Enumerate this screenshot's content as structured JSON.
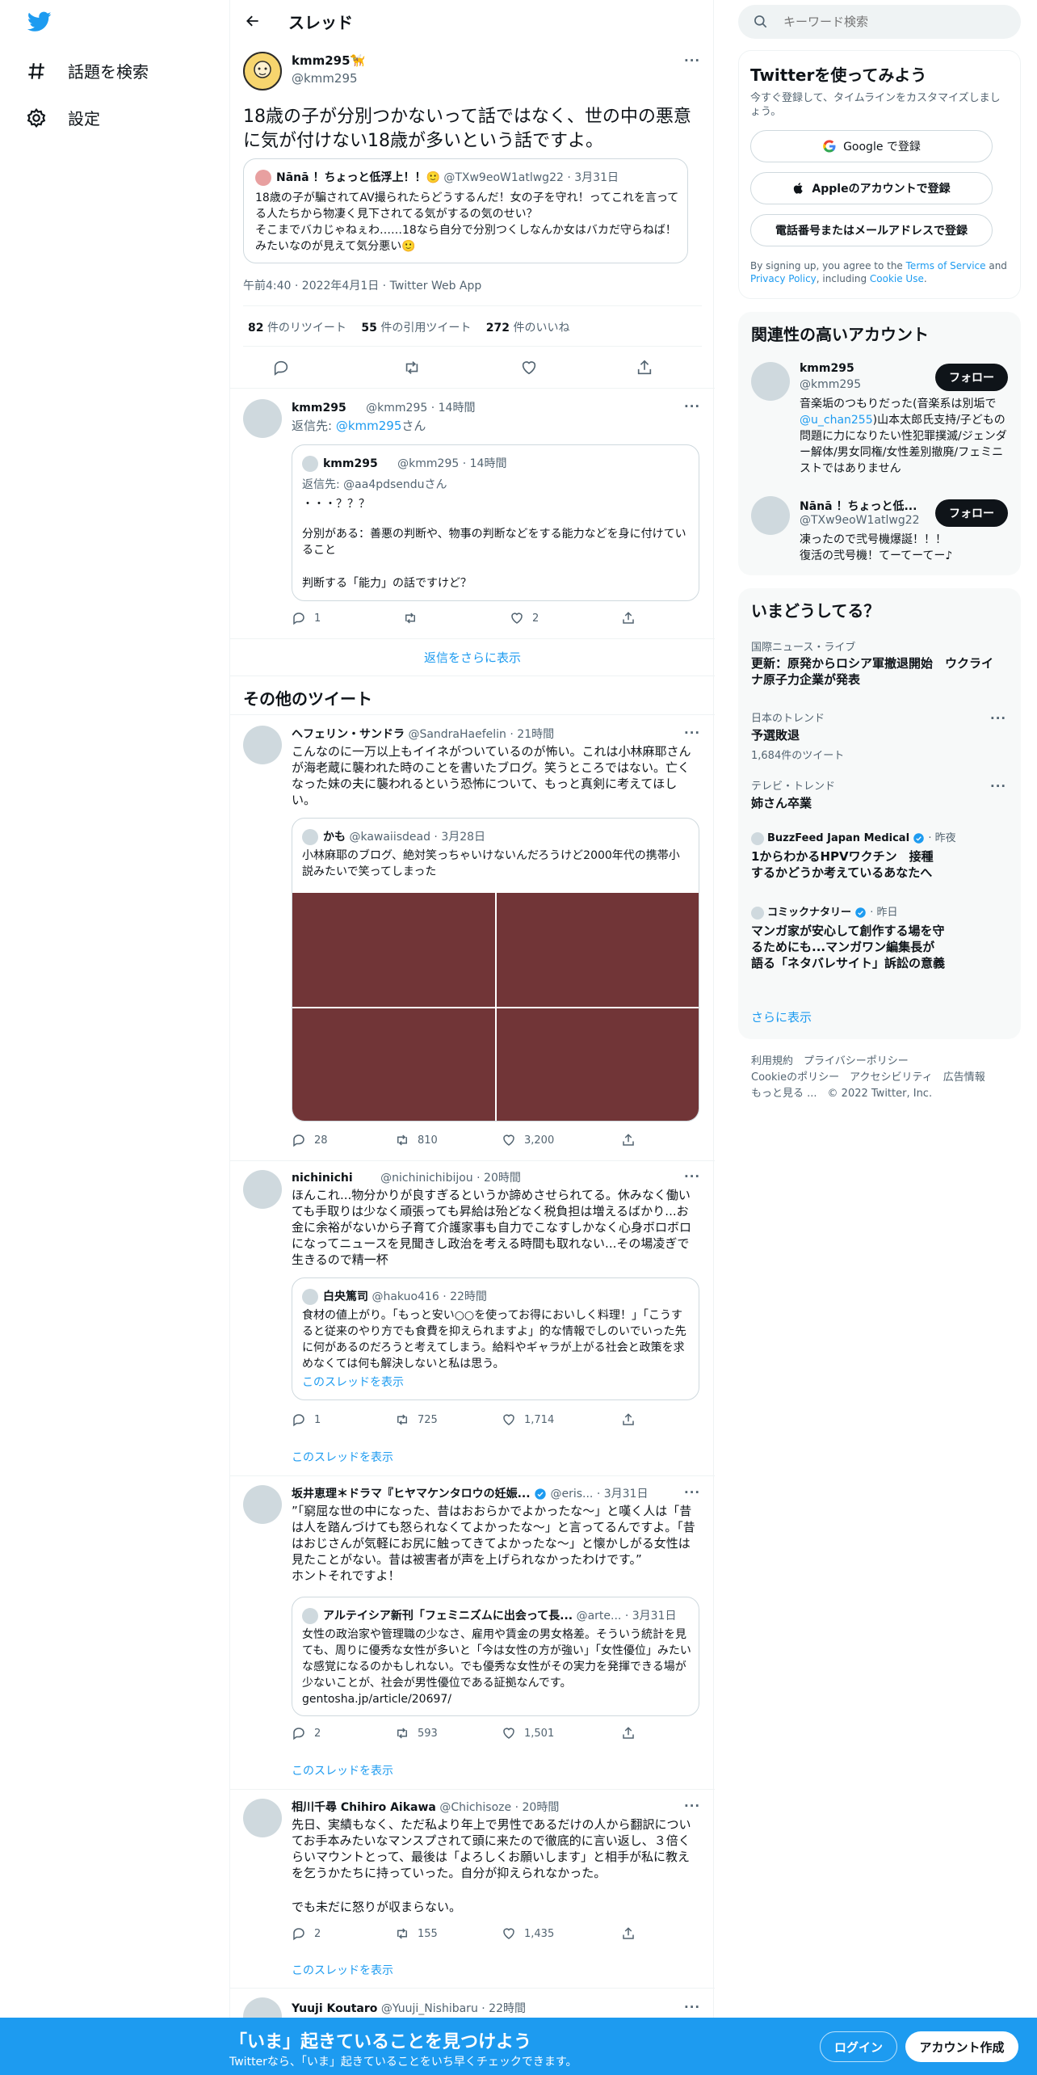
{
  "nav": {
    "explore": "話題を検索",
    "settings": "設定"
  },
  "header": {
    "title": "スレッド"
  },
  "main_tweet": {
    "name": "kmm295🦮",
    "handle": "@kmm295",
    "text": "18歳の子が分別つかないって話ではなく、世の中の悪意に気が付けない18歳が多いという話ですよ。",
    "quote": {
      "name": "Nānā ！ちょっと低浮上！！🙂",
      "handle": "@TXw9eoW1atlwg22",
      "date": "3月31日",
      "text": "18歳の子が騙されてAV撮られたらどうするんだ！女の子を守れ！ってこれを言ってる人たちから物凄く見下されてる気がするの気のせい？\nそこまでバカじゃねぇわ……18なら自分で分別つくしなんか女はバカだ守らねば！みたいなのが見えて気分悪い🙂"
    },
    "timestamp": "午前4:40 · 2022年4月1日 · Twitter Web App",
    "retweets_num": "82",
    "retweets_label": "件のリツイート",
    "quotes_num": "55",
    "quotes_label": "件の引用ツイート",
    "likes_num": "272",
    "likes_label": "件のいいね"
  },
  "reply": {
    "name": "kmm295",
    "handle": "@kmm295",
    "time": "14時間",
    "reply_to_prefix": "返信先: ",
    "reply_to_handle": "@kmm295",
    "reply_to_suffix": "さん",
    "quote": {
      "name": "kmm295",
      "handle": "@kmm295",
      "time": "14時間",
      "reply_to": "返信先: @aa4pdsendu",
      "reply_to_suffix": "さん",
      "line1": "・・・？？？",
      "line2": "分別がある：善悪の判断や、物事の判断などをする能力などを身に付けていること",
      "line3": "判断する「能力」の話ですけど？"
    },
    "replies": "1",
    "likes": "2",
    "show_more": "返信をさらに表示"
  },
  "other_tweets_title": "その他のツイート",
  "tweets": [
    {
      "name": "ヘフェリン・サンドラ",
      "handle": "@SandraHaefelin",
      "time": "21時間",
      "text": "こんなのに一万以上もイイネがついているのが怖い。これは小林麻耶さんが海老蔵に襲われた時のことを書いたブログ。笑うところではない。亡くなった妹の夫に襲われるという恐怖について、もっと真剣に考えてほしい。",
      "quote_name": "かも",
      "quote_handle": "@kawaiisdead",
      "quote_date": "3月28日",
      "quote_text": "小林麻耶のブログ、絶対笑っちゃいけないんだろうけど2000年代の携帯小説みたいで笑ってしまった",
      "replies": "28",
      "retweets": "810",
      "likes": "3,200"
    },
    {
      "name": "nichinichi",
      "handle": "@nichinichibijou",
      "time": "20時間",
      "text": "ほんこれ...物分かりが良すぎるというか諦めさせられてる。休みなく働いても手取りは少なく頑張っても昇給は殆どなく税負担は増えるばかり...お金に余裕がないから子育て介護家事も自力でこなすしかなく心身ボロボロになってニュースを見聞きし政治を考える時間も取れない...その場凌ぎで生きるので精一杯",
      "quote_name": "白央篤司",
      "quote_handle": "@hakuo416",
      "quote_date": "22時間",
      "quote_text": "食材の値上がり。「もっと安い○○を使ってお得においしく料理！」「こうすると従来のやり方でも食費を抑えられますよ」的な情報でしのいでいった先に何があるのだろうと考えてしまう。給料やギャラが上がる社会と政策を求めなくては何も解決しないと私は思う。",
      "quote_thread": "このスレッドを表示",
      "replies": "1",
      "retweets": "725",
      "likes": "1,714",
      "show_thread": "このスレッドを表示"
    },
    {
      "name": "坂井恵理＊ドラマ『ヒヤマケンタロウの妊娠...",
      "handle": "@eris...",
      "time": "3月31日",
      "text": "”「窮屈な世の中になった、昔はおおらかでよかったな～」と嘆く人は「昔は人を踏んづけても怒られなくてよかったな～」と言ってるんですよ。「昔はおじさんが気軽にお尻に触ってきてよかったな～」と懐かしがる女性は見たことがない。昔は被害者が声を上げられなかったわけです。”\nホントそれですよ！",
      "quote_name": "アルテイシア新刊「フェミニズムに出会って長...",
      "quote_handle": "@arte...",
      "quote_date": "3月31日",
      "quote_text": "女性の政治家や管理職の少なさ、雇用や賃金の男女格差。そういう統計を見ても、周りに優秀な女性が多いと「今は女性の方が強い」「女性優位」みたいな感覚になるのかもしれない。でも優秀な女性がその実力を発揮できる場が少ないことが、社会が男性優位である証拠なんです。gentosha.jp/article/20697/",
      "replies": "2",
      "retweets": "593",
      "likes": "1,501",
      "show_thread": "このスレッドを表示"
    },
    {
      "name": "相川千尋 Chihiro Aikawa",
      "handle": "@Chichisoze",
      "time": "20時間",
      "text": "先日、実績もなく、ただ私より年上で男性であるだけの人から翻訳についてお手本みたいなマンスプされて頭に来たので徹底的に言い返し、３倍くらいマウントとって、最後は「よろしくお願いします」と相手が私に教えを乞うかたちに持っていった。自分が抑えられなかった。",
      "text2": "でも未だに怒りが収まらない。",
      "replies": "2",
      "retweets": "155",
      "likes": "1,435",
      "show_thread": "このスレッドを表示"
    },
    {
      "name": "Yuuji Koutaro",
      "handle": "@Yuuji_Nishibaru",
      "time": "22時間"
    }
  ],
  "right": {
    "search_placeholder": "キーワード検索",
    "signup": {
      "title": "Twitterを使ってみよう",
      "subtitle": "今すぐ登録して、タイムラインをカスタマイズしましょう。",
      "google": "Google で登録",
      "apple": "Appleのアカウントで登録",
      "phone": "電話番号またはメールアドレスで登録",
      "legal_prefix": "By signing up, you agree to the ",
      "terms": "Terms of Service",
      "legal_and": " and ",
      "privacy": "Privacy Policy",
      "legal_including": ", including ",
      "cookie": "Cookie Use",
      "legal_end": "."
    },
    "related": {
      "title": "関連性の高いアカウント",
      "follow": "フォロー",
      "accounts": [
        {
          "name": "kmm295",
          "handle": "@kmm295",
          "bio_pre": "音楽垢のつもりだった(音楽系は別垢で",
          "bio_link": "@u_chan255",
          "bio_post": ")山本太郎氏支持/子どもの問題に力になりたい性犯罪撲滅/ジェンダー解体/男女同権/女性差別撤廃/フェミニストではありません"
        },
        {
          "name": "Nānā ！ちょっと低...",
          "handle": "@TXw9eoW1atlwg22",
          "bio": "凍ったので弐号機爆誕！！！\n復活の弐号機！てーてーてー♪"
        }
      ]
    },
    "trends": {
      "title": "いまどうしてる？",
      "items": [
        {
          "context": "国際ニュース・ライブ",
          "title": "更新：原発からロシア軍撤退開始　ウクライナ原子力企業が発表"
        },
        {
          "context": "日本のトレンド",
          "title": "予選敗退",
          "count": "1,684件のツイート"
        },
        {
          "context": "テレビ・トレンド",
          "title": "姉さん卒業"
        },
        {
          "source": "BuzzFeed Japan Medical",
          "time": "· 昨夜",
          "title": "1からわかるHPVワクチン　接種するかどうか考えているあなたへ"
        },
        {
          "source": "コミックナタリー",
          "time": "· 昨日",
          "title": "マンガ家が安心して創作する場を守るためにも...マンガワン編集長が語る「ネタバレサイト」訴訟の意義"
        }
      ],
      "show_more": "さらに表示"
    },
    "footer": {
      "line1a": "利用規約",
      "line1b": "プライバシーポリシー",
      "line2a": "Cookieのポリシー",
      "line2b": "アクセシビリティ",
      "line2c": "広告情報",
      "line3a": "もっと見る ...",
      "line3b": "© 2022 Twitter, Inc."
    }
  },
  "bottom": {
    "title": "「いま」起きていることを見つけよう",
    "subtitle": "Twitterなら、「いま」起きていることをいち早くチェックできます。",
    "login": "ログイン",
    "signup": "アカウント作成"
  },
  "colors": {
    "accent": "#1d9bf0",
    "text": "#0f1419",
    "muted": "#536471",
    "border": "#cfd9de",
    "media": "#713537"
  }
}
